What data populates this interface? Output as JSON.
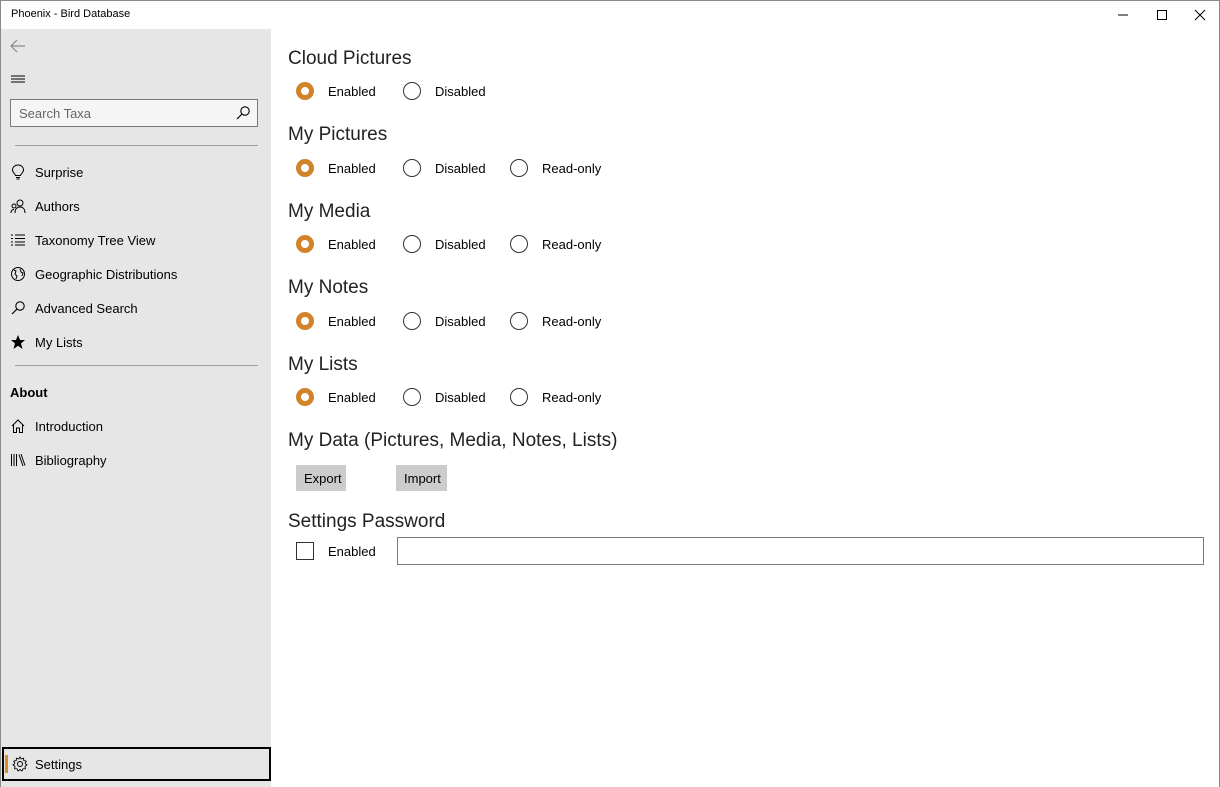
{
  "window": {
    "title": "Phoenix - Bird Database"
  },
  "sidebar": {
    "search": {
      "placeholder": "Search Taxa",
      "value": ""
    },
    "items": [
      {
        "label": "Surprise",
        "icon": "lightbulb-icon"
      },
      {
        "label": "Authors",
        "icon": "authors-icon"
      },
      {
        "label": "Taxonomy Tree View",
        "icon": "list-icon"
      },
      {
        "label": "Geographic Distributions",
        "icon": "globe-icon"
      },
      {
        "label": "Advanced Search",
        "icon": "search-icon"
      },
      {
        "label": "My Lists",
        "icon": "star-icon"
      }
    ],
    "about_heading": "About",
    "about_items": [
      {
        "label": "Introduction",
        "icon": "home-icon"
      },
      {
        "label": "Bibliography",
        "icon": "library-icon"
      }
    ],
    "settings_label": "Settings"
  },
  "main": {
    "cloud_pictures": {
      "title": "Cloud Pictures",
      "options": [
        "Enabled",
        "Disabled"
      ],
      "selected": "Enabled"
    },
    "my_pictures": {
      "title": "My Pictures",
      "options": [
        "Enabled",
        "Disabled",
        "Read-only"
      ],
      "selected": "Enabled"
    },
    "my_media": {
      "title": "My Media",
      "options": [
        "Enabled",
        "Disabled",
        "Read-only"
      ],
      "selected": "Enabled"
    },
    "my_notes": {
      "title": "My Notes",
      "options": [
        "Enabled",
        "Disabled",
        "Read-only"
      ],
      "selected": "Enabled"
    },
    "my_lists": {
      "title": "My Lists",
      "options": [
        "Enabled",
        "Disabled",
        "Read-only"
      ],
      "selected": "Enabled"
    },
    "my_data": {
      "title": "My Data (Pictures, Media, Notes, Lists)",
      "export_label": "Export",
      "import_label": "Import"
    },
    "settings_password": {
      "title": "Settings Password",
      "checkbox_label": "Enabled",
      "checked": false,
      "password_value": ""
    }
  },
  "colors": {
    "accent": "#d2832a",
    "sidebar_bg": "#e6e6e6",
    "button_bg": "#cccccc"
  }
}
